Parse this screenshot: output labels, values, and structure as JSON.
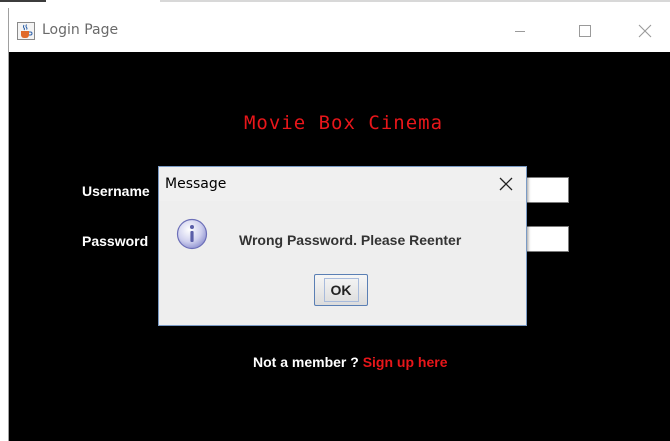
{
  "window": {
    "title": "Login Page",
    "app_icon": "java-cup-icon",
    "controls": [
      "minimize-icon",
      "maximize-icon",
      "close-icon"
    ]
  },
  "form": {
    "heading": "Movie Box Cinema",
    "username_label": "Username",
    "password_label": "Password",
    "username_value": "",
    "password_value": "",
    "signup_prefix": "Not a member ?",
    "signup_link": "Sign up here"
  },
  "dialog": {
    "title": "Message",
    "icon": "information-icon",
    "message": "Wrong Password. Please Reenter",
    "ok_label": "OK"
  },
  "colors": {
    "background": "#000000",
    "accent_red": "#e8161a",
    "label_white": "#ffffff",
    "dialog_bg": "#eeeeee"
  }
}
